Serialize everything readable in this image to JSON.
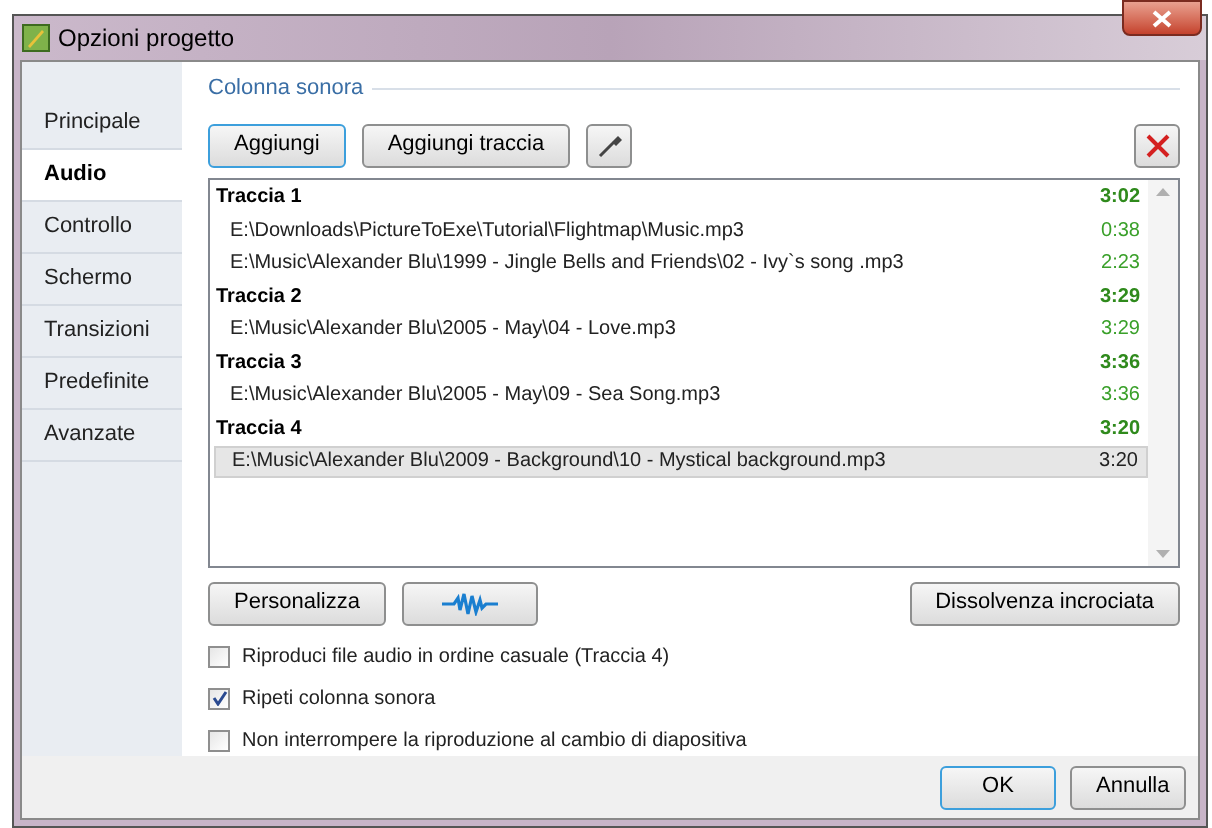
{
  "window": {
    "title": "Opzioni progetto"
  },
  "sidebar": {
    "items": [
      {
        "label": "Principale",
        "selected": false
      },
      {
        "label": "Audio",
        "selected": true
      },
      {
        "label": "Controllo",
        "selected": false
      },
      {
        "label": "Schermo",
        "selected": false
      },
      {
        "label": "Transizioni",
        "selected": false
      },
      {
        "label": "Predefinite",
        "selected": false
      },
      {
        "label": "Avanzate",
        "selected": false
      }
    ]
  },
  "section": {
    "title": "Colonna sonora"
  },
  "toolbar": {
    "buttons": [
      {
        "label": "Aggiungi",
        "focused": true
      },
      {
        "label": "Aggiungi traccia",
        "focused": false
      }
    ]
  },
  "tracks": [
    {
      "name": "Traccia 1",
      "duration": "3:02",
      "children": [
        {
          "path": "E:\\Downloads\\PictureToExe\\Tutorial\\Flightmap\\Music.mp3",
          "duration": "0:38",
          "selected": false
        },
        {
          "path": "E:\\Music\\Alexander Blu\\1999 - Jingle Bells and Friends\\02 - Ivy`s song .mp3",
          "duration": "2:23",
          "selected": false
        }
      ]
    },
    {
      "name": "Traccia 2",
      "duration": "3:29",
      "children": [
        {
          "path": "E:\\Music\\Alexander Blu\\2005 - May\\04 - Love.mp3",
          "duration": "3:29",
          "selected": false
        }
      ]
    },
    {
      "name": "Traccia 3",
      "duration": "3:36",
      "children": [
        {
          "path": "E:\\Music\\Alexander Blu\\2005 - May\\09 - Sea Song.mp3",
          "duration": "3:36",
          "selected": false
        }
      ]
    },
    {
      "name": "Traccia 4",
      "duration": "3:20",
      "children": [
        {
          "path": "E:\\Music\\Alexander Blu\\2009 - Background\\10 - Mystical background.mp3",
          "duration": "3:20",
          "selected": true
        }
      ]
    }
  ],
  "list_buttons": {
    "customize": "Personalizza",
    "crossfade": "Dissolvenza incrociata"
  },
  "options": [
    {
      "label": "Riproduci file audio in ordine casuale (Traccia 4)",
      "checked": false
    },
    {
      "label": "Ripeti colonna sonora",
      "checked": true
    },
    {
      "label": "Non interrompere la riproduzione al cambio di diapositiva",
      "checked": false
    }
  ],
  "footer": {
    "buttons": [
      {
        "label": "OK",
        "focused": true
      },
      {
        "label": "Annulla",
        "focused": false
      }
    ]
  }
}
